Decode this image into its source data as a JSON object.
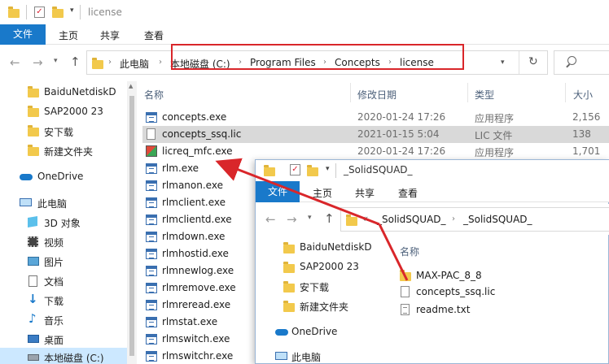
{
  "window": {
    "title": "license"
  },
  "ribbon": {
    "file_tab": "文件",
    "tabs": [
      "主页",
      "共享",
      "查看"
    ]
  },
  "address": {
    "crumbs": [
      "此电脑",
      "本地磁盘 (C:)",
      "Program Files",
      "Concepts",
      "license"
    ],
    "search_icon": "search-icon"
  },
  "sidebar": {
    "items": [
      "BaiduNetdiskD",
      "SAP2000 23",
      "安下载",
      "新建文件夹",
      "OneDrive",
      "此电脑",
      "3D 对象",
      "视频",
      "图片",
      "文档",
      "下载",
      "音乐",
      "桌面",
      "本地磁盘 (C:)"
    ]
  },
  "columns": {
    "name": "名称",
    "date": "修改日期",
    "type": "类型",
    "size": "大小"
  },
  "files": [
    {
      "name": "concepts.exe",
      "date": "2020-01-24 17:26",
      "type": "应用程序",
      "size": "2,156"
    },
    {
      "name": "concepts_ssq.lic",
      "date": "2021-01-15 5:04",
      "type": "LIC 文件",
      "size": "138"
    },
    {
      "name": "licreq_mfc.exe",
      "date": "2020-01-24 17:26",
      "type": "应用程序",
      "size": "1,701"
    },
    {
      "name": "rlm.exe",
      "date": "",
      "type": "",
      "size": ""
    },
    {
      "name": "rlmanon.exe",
      "date": "",
      "type": "",
      "size": ""
    },
    {
      "name": "rlmclient.exe",
      "date": "",
      "type": "",
      "size": ""
    },
    {
      "name": "rlmclientd.exe",
      "date": "",
      "type": "",
      "size": ""
    },
    {
      "name": "rlmdown.exe",
      "date": "",
      "type": "",
      "size": ""
    },
    {
      "name": "rlmhostid.exe",
      "date": "",
      "type": "",
      "size": ""
    },
    {
      "name": "rlmnewlog.exe",
      "date": "",
      "type": "",
      "size": ""
    },
    {
      "name": "rlmremove.exe",
      "date": "",
      "type": "",
      "size": ""
    },
    {
      "name": "rlmreread.exe",
      "date": "",
      "type": "",
      "size": ""
    },
    {
      "name": "rlmstat.exe",
      "date": "",
      "type": "",
      "size": ""
    },
    {
      "name": "rlmswitch.exe",
      "date": "",
      "type": "",
      "size": ""
    },
    {
      "name": "rlmswitchr.exe",
      "date": "",
      "type": "",
      "size": ""
    }
  ],
  "second_window": {
    "title": "_SolidSQUAD_",
    "file_tab": "文件",
    "tabs": [
      "主页",
      "共享",
      "查看"
    ],
    "crumbs": [
      "«",
      "_SolidSQUAD_",
      "_SolidSQUAD_"
    ],
    "sidebar": [
      "BaiduNetdiskD",
      "SAP2000 23",
      "安下载",
      "新建文件夹",
      "OneDrive",
      "此电脑"
    ],
    "col_name": "名称",
    "files": [
      "MAX-PAC_8_8",
      "concepts_ssq.lic",
      "readme.txt"
    ]
  },
  "colors": {
    "accent": "#1979ca",
    "highlight": "#e5f3ff",
    "selected": "#cde0f5",
    "annotation": "#d9262a"
  }
}
